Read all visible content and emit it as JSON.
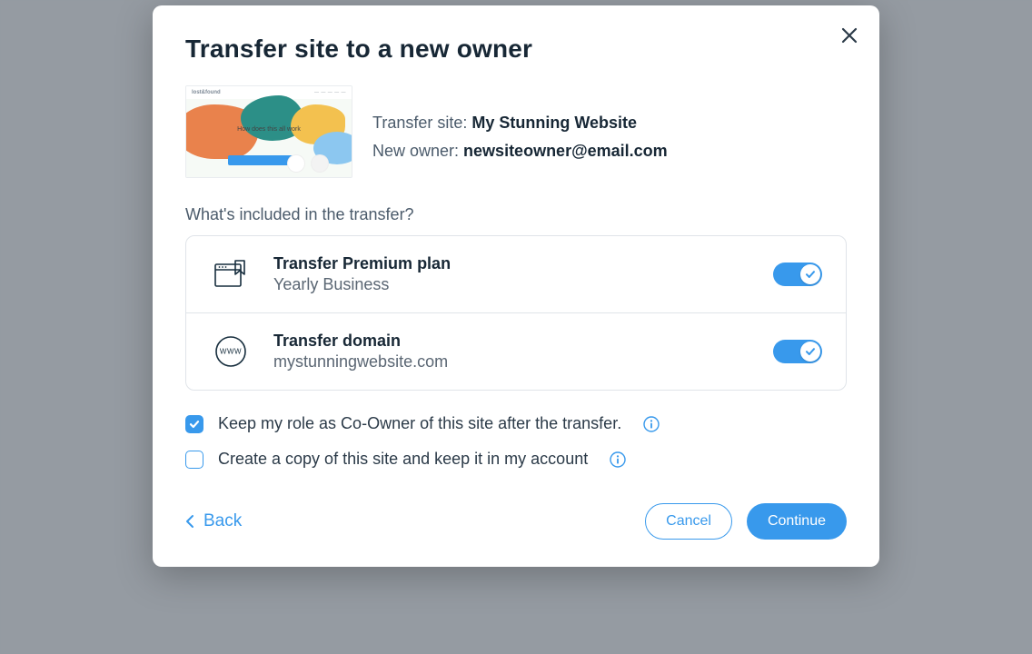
{
  "modal": {
    "title": "Transfer site to a new owner",
    "transfer_label": "Transfer site: ",
    "site_name": "My Stunning Website",
    "owner_label": "New owner: ",
    "owner_email": "newsiteowner@email.com",
    "included_label": "What's included in the transfer?",
    "items": [
      {
        "icon": "plan",
        "title": "Transfer Premium plan",
        "sub": "Yearly Business",
        "on": true
      },
      {
        "icon": "domain",
        "title": "Transfer domain",
        "sub": "mystunningwebsite.com",
        "on": true
      }
    ],
    "checks": [
      {
        "label": "Keep my role as Co-Owner of this site after the transfer.",
        "checked": true,
        "info": true
      },
      {
        "label": "Create a copy of this site and keep it in my account",
        "checked": false,
        "info": true
      }
    ],
    "back_label": "Back",
    "cancel_label": "Cancel",
    "continue_label": "Continue"
  }
}
